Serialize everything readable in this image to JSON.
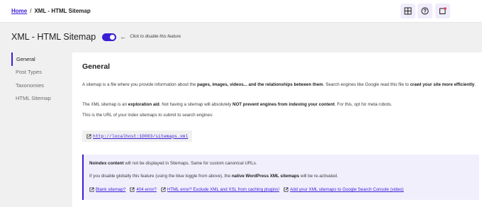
{
  "breadcrumb": {
    "home": "Home",
    "separator": "/",
    "current": "XML - HTML Sitemap"
  },
  "toolbar": {
    "icons": [
      "grid-icon",
      "help-icon",
      "notification-icon"
    ],
    "notification_color": "#e03c5a"
  },
  "header": {
    "title": "XML - HTML Sitemap",
    "toggle_state": "on",
    "arrow": "←",
    "hint": "Click to disable this feature"
  },
  "sidebar": {
    "items": [
      {
        "label": "General",
        "active": true
      },
      {
        "label": "Post Types",
        "active": false
      },
      {
        "label": "Taxonomies",
        "active": false
      },
      {
        "label": "HTML Sitemap",
        "active": false
      }
    ]
  },
  "panel": {
    "title": "General",
    "p1": {
      "a": "A sitemap is a file where you provide information about the ",
      "b": "pages, images, videos... and the relationships between them",
      "c": ". Search engines like Google read this file to ",
      "d": "crawl your site more efficiently",
      "e": "."
    },
    "p2": {
      "a": "The XML sitemap is an ",
      "b": "exploration aid",
      "c": ". Not having a sitemap will absolutely ",
      "d": "NOT prevent engines from indexing your content",
      "e": ". For this, opt for meta robots."
    },
    "p3": "This is the URL of your index sitemaps to submit to search engines:",
    "url": "http://localhost:10003/sitemaps.xml",
    "notice": {
      "l1a": "Noindex content",
      "l1b": " will not be displayed in Sitemaps. Same for custom canonical URLs.",
      "l2a": "If you disable globally this feature (using the blue toggle from above), the ",
      "l2b": "native WordPress XML sitemaps",
      "l2c": " will be re-activated.",
      "links": [
        "Blank sitemap?",
        "404 error?",
        "HTML error? Exclude XML and XSL from caching plugins!",
        "Add your XML sitemaps to Google Search Console (video)"
      ]
    }
  },
  "colors": {
    "accent": "#3a1fd6",
    "notice_bg": "#f2effd",
    "page_bg": "#f0f0f1"
  }
}
